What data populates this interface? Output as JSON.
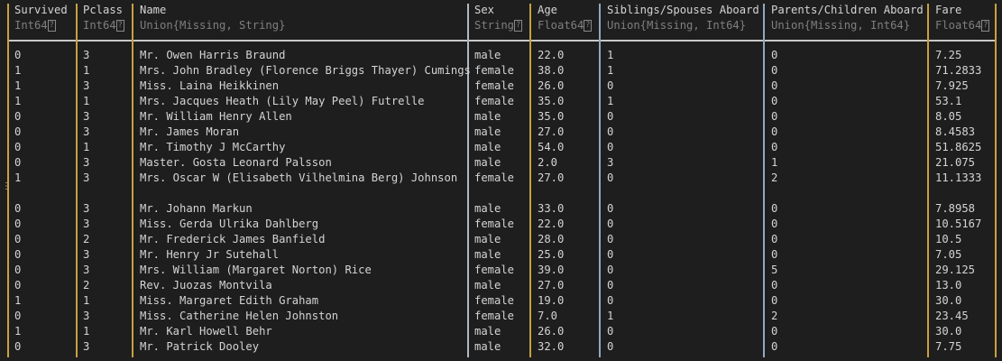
{
  "columns": [
    {
      "name": "Survived",
      "type": "Int64",
      "q": true
    },
    {
      "name": "Pclass",
      "type": "Int64",
      "q": true
    },
    {
      "name": "Name",
      "type": "Union{Missing, String}",
      "q": false
    },
    {
      "name": "Sex",
      "type": "String",
      "q": true
    },
    {
      "name": "Age",
      "type": "Float64",
      "q": true
    },
    {
      "name": "Siblings/Spouses Aboard",
      "type": "Union{Missing, Int64}",
      "q": false
    },
    {
      "name": "Parents/Children Aboard",
      "type": "Union{Missing, Int64}",
      "q": false
    },
    {
      "name": "Fare",
      "type": "Float64",
      "q": true
    }
  ],
  "q_glyph": "?",
  "ellipsis": "⋮",
  "rows_top": [
    [
      "0",
      "3",
      "Mr. Owen Harris Braund",
      "male",
      "22.0",
      "1",
      "0",
      "7.25"
    ],
    [
      "1",
      "1",
      "Mrs. John Bradley (Florence Briggs Thayer) Cumings",
      "female",
      "38.0",
      "1",
      "0",
      "71.2833"
    ],
    [
      "1",
      "3",
      "Miss. Laina Heikkinen",
      "female",
      "26.0",
      "0",
      "0",
      "7.925"
    ],
    [
      "1",
      "1",
      "Mrs. Jacques Heath (Lily May Peel) Futrelle",
      "female",
      "35.0",
      "1",
      "0",
      "53.1"
    ],
    [
      "0",
      "3",
      "Mr. William Henry Allen",
      "male",
      "35.0",
      "0",
      "0",
      "8.05"
    ],
    [
      "0",
      "3",
      "Mr. James Moran",
      "male",
      "27.0",
      "0",
      "0",
      "8.4583"
    ],
    [
      "0",
      "1",
      "Mr. Timothy J McCarthy",
      "male",
      "54.0",
      "0",
      "0",
      "51.8625"
    ],
    [
      "0",
      "3",
      "Master. Gosta Leonard Palsson",
      "male",
      "2.0",
      "3",
      "1",
      "21.075"
    ],
    [
      "1",
      "3",
      "Mrs. Oscar W (Elisabeth Vilhelmina Berg) Johnson",
      "female",
      "27.0",
      "0",
      "2",
      "11.1333"
    ]
  ],
  "rows_bottom": [
    [
      "0",
      "3",
      "Mr. Johann Markun",
      "male",
      "33.0",
      "0",
      "0",
      "7.8958"
    ],
    [
      "0",
      "3",
      "Miss. Gerda Ulrika Dahlberg",
      "female",
      "22.0",
      "0",
      "0",
      "10.5167"
    ],
    [
      "0",
      "2",
      "Mr. Frederick James Banfield",
      "male",
      "28.0",
      "0",
      "0",
      "10.5"
    ],
    [
      "0",
      "3",
      "Mr. Henry Jr Sutehall",
      "male",
      "25.0",
      "0",
      "0",
      "7.05"
    ],
    [
      "0",
      "3",
      "Mrs. William (Margaret Norton) Rice",
      "female",
      "39.0",
      "0",
      "5",
      "29.125"
    ],
    [
      "0",
      "2",
      "Rev. Juozas Montvila",
      "male",
      "27.0",
      "0",
      "0",
      "13.0"
    ],
    [
      "1",
      "1",
      "Miss. Margaret Edith Graham",
      "female",
      "19.0",
      "0",
      "0",
      "30.0"
    ],
    [
      "0",
      "3",
      "Miss. Catherine Helen Johnston",
      "female",
      "7.0",
      "1",
      "2",
      "23.45"
    ],
    [
      "1",
      "1",
      "Mr. Karl Howell Behr",
      "male",
      "26.0",
      "0",
      "0",
      "30.0"
    ],
    [
      "0",
      "3",
      "Mr. Patrick Dooley",
      "male",
      "32.0",
      "0",
      "0",
      "7.75"
    ]
  ]
}
